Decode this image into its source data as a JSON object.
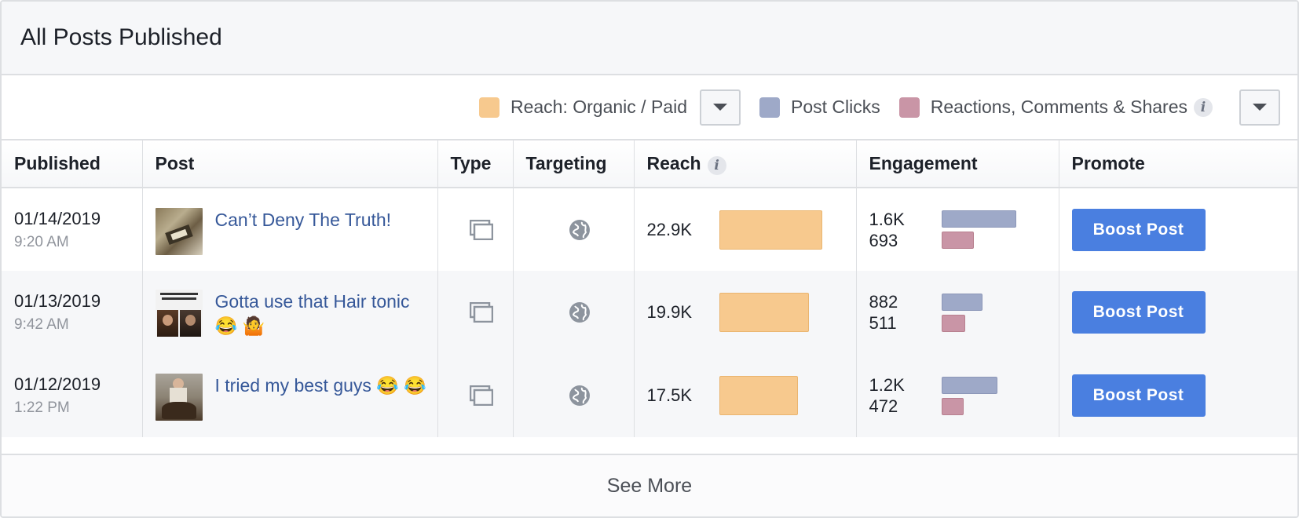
{
  "panel": {
    "title": "All Posts Published"
  },
  "legend": {
    "reach_label": "Reach: Organic / Paid",
    "clicks_label": "Post Clicks",
    "reactions_label": "Reactions, Comments & Shares",
    "info_glyph": "i",
    "colors": {
      "reach": "#f7c98e",
      "clicks": "#9ea9c8",
      "reactions": "#c995a6"
    }
  },
  "table": {
    "headers": {
      "published": "Published",
      "post": "Post",
      "type": "Type",
      "targeting": "Targeting",
      "reach": "Reach",
      "engagement": "Engagement",
      "promote": "Promote"
    },
    "rows": [
      {
        "date": "01/14/2019",
        "time": "9:20 AM",
        "post_title": "Can’t Deny The Truth!",
        "type_icon": "multi-photo-icon",
        "targeting_icon": "globe-icon",
        "reach": "22.9K",
        "reach_value": 22900,
        "clicks": "1.6K",
        "clicks_value": 1600,
        "reactions": "693",
        "reactions_value": 693,
        "boost_label": "Boost Post"
      },
      {
        "date": "01/13/2019",
        "time": "9:42 AM",
        "post_title": "Gotta use that Hair tonic 😂 🤷",
        "type_icon": "multi-photo-icon",
        "targeting_icon": "globe-icon",
        "reach": "19.9K",
        "reach_value": 19900,
        "clicks": "882",
        "clicks_value": 882,
        "reactions": "511",
        "reactions_value": 511,
        "boost_label": "Boost Post"
      },
      {
        "date": "01/12/2019",
        "time": "1:22 PM",
        "post_title": "I tried my best guys 😂 😂",
        "type_icon": "multi-photo-icon",
        "targeting_icon": "globe-icon",
        "reach": "17.5K",
        "reach_value": 17500,
        "clicks": "1.2K",
        "clicks_value": 1200,
        "reactions": "472",
        "reactions_value": 472,
        "boost_label": "Boost Post"
      }
    ]
  },
  "footer": {
    "see_more": "See More"
  }
}
